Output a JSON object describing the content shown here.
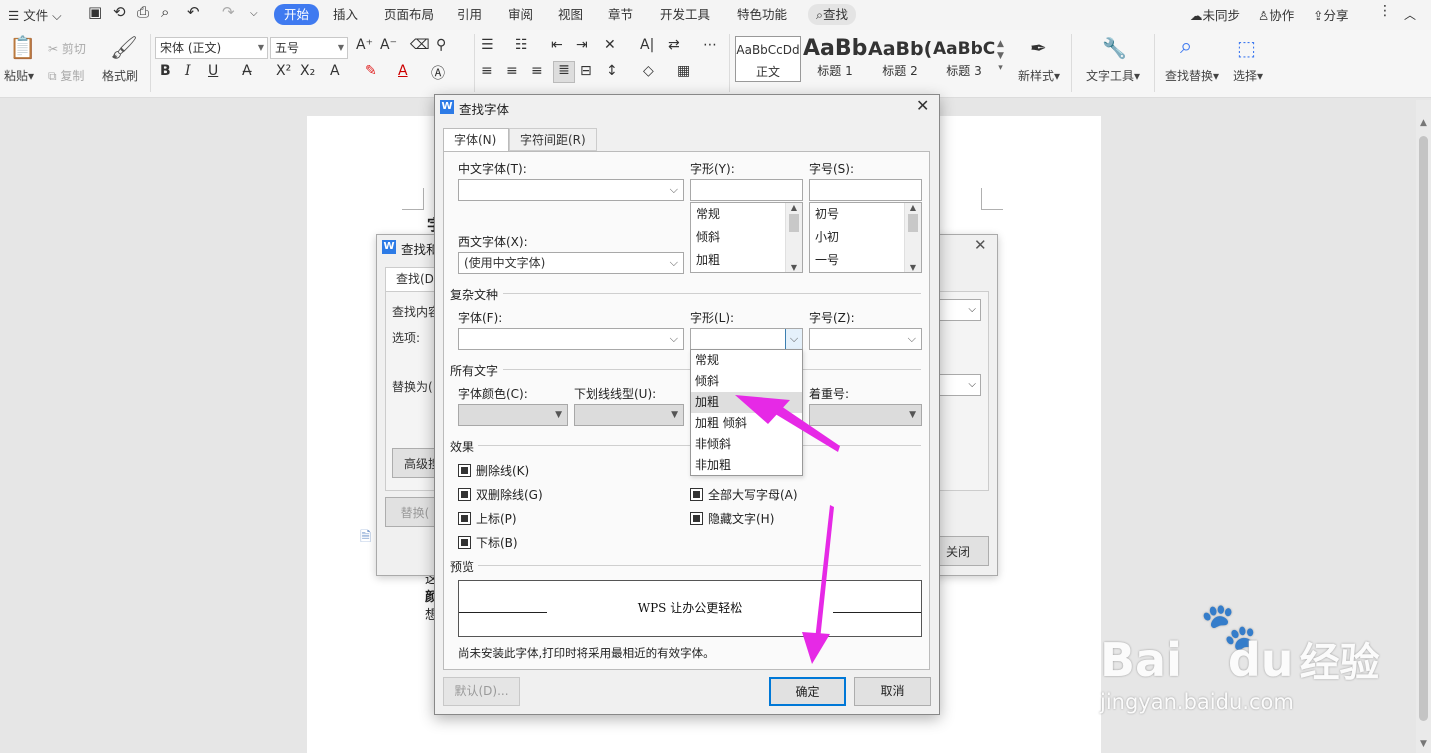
{
  "menubar": {
    "file": "文件",
    "tabs": [
      "开始",
      "插入",
      "页面布局",
      "引用",
      "审阅",
      "视图",
      "章节",
      "开发工具",
      "特色功能"
    ],
    "search": "查找",
    "right": [
      "未同步",
      "协作",
      "分享"
    ]
  },
  "ribbon": {
    "paste": "粘贴",
    "cut": "剪切",
    "copy": "复制",
    "format_painter": "格式刷",
    "font_name": "宋体 (正文)",
    "font_size": "五号",
    "styles": [
      {
        "preview": "AaBbCcDd",
        "label": "正文"
      },
      {
        "preview": "AaBb",
        "label": "标题 1"
      },
      {
        "preview": "AaBb(",
        "label": "标题 2"
      },
      {
        "preview": "AaBbC(",
        "label": "标题 3"
      }
    ],
    "new_style": "新样式",
    "text_tools": "文字工具",
    "find_replace": "查找替换",
    "select": "选择"
  },
  "find_dialog": {
    "title": "查找和",
    "tab": "查找(D",
    "find_label": "查找内容",
    "options_label": "选项:",
    "replace_label": "替换为(",
    "advanced_button": "高级搜",
    "replace_button": "替换(",
    "close_button": "关闭"
  },
  "font_dialog": {
    "title": "查找字体",
    "tabs": [
      "字体(N)",
      "字符间距(R)"
    ],
    "chinese_font_label": "中文字体(T):",
    "chinese_font_value": "",
    "style_label": "字形(Y):",
    "size_label": "字号(S):",
    "style_list": [
      "常规",
      "倾斜",
      "加粗"
    ],
    "size_list": [
      "初号",
      "小初",
      "一号"
    ],
    "western_font_label": "西文字体(X):",
    "western_font_value": "(使用中文字体)",
    "complex_group": "复杂文种",
    "complex_font_label": "字体(F):",
    "complex_style_label": "字形(L):",
    "complex_size_label": "字号(Z):",
    "all_text_group": "所有文字",
    "font_color_label": "字体颜色(C):",
    "underline_label": "下划线线型(U):",
    "emphasis_label": "着重号:",
    "effects_group": "效果",
    "effects_left": [
      "删除线(K)",
      "双删除线(G)",
      "上标(P)",
      "下标(B)"
    ],
    "effects_right": [
      "全部大写字母(A)",
      "隐藏文字(H)"
    ],
    "preview_group": "预览",
    "preview_text": "WPS 让办公更轻松",
    "note": "尚未安装此字体,打印时将采用最相近的有效字体。",
    "default_button": "默认(D)...",
    "ok_button": "确定",
    "cancel_button": "取消",
    "dropdown_options": [
      "常规",
      "倾斜",
      "加粗",
      "加粗 倾斜",
      "非倾斜",
      "非加粗"
    ],
    "dropdown_selected": "加粗"
  },
  "watermark": {
    "brand": "Bai",
    "brand2": "du",
    "brand_cn": "经验",
    "url": "jingyan.baidu.com"
  },
  "colors": {
    "accent": "#3f7af0",
    "arrow": "#e629e6",
    "app_icon": "#2d7be6"
  }
}
